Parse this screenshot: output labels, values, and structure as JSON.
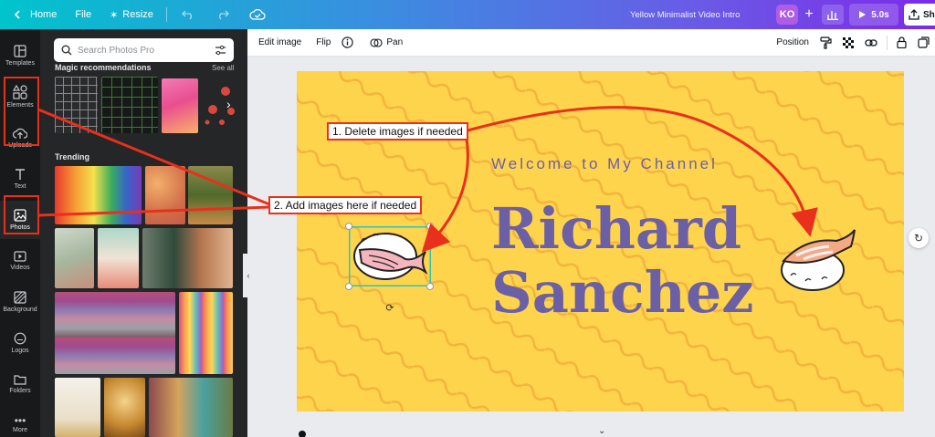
{
  "topbar": {
    "home_label": "Home",
    "file_label": "File",
    "resize_label": "Resize",
    "doc_title": "Yellow Minimalist Video Intro",
    "avatar_initials": "KO",
    "play_label": "5.0s",
    "share_label": "Sh"
  },
  "rail": {
    "items": [
      {
        "label": "Templates",
        "icon": "templates-icon"
      },
      {
        "label": "Elements",
        "icon": "elements-icon"
      },
      {
        "label": "Uploads",
        "icon": "upload-icon"
      },
      {
        "label": "Text",
        "icon": "text-icon"
      },
      {
        "label": "Photos",
        "icon": "photos-icon"
      },
      {
        "label": "Videos",
        "icon": "videos-icon"
      },
      {
        "label": "Background",
        "icon": "background-icon"
      },
      {
        "label": "Logos",
        "icon": "logos-icon"
      },
      {
        "label": "Folders",
        "icon": "folders-icon"
      },
      {
        "label": "More",
        "icon": "more-icon"
      }
    ]
  },
  "panel": {
    "search_placeholder": "Search Photos Pro",
    "magic_title": "Magic recommendations",
    "see_all": "See all",
    "trending_title": "Trending"
  },
  "ctx": {
    "edit_image": "Edit image",
    "flip": "Flip",
    "pan": "Pan",
    "position": "Position"
  },
  "canvas": {
    "welcome": "Welcome to My Channel",
    "name_line1": "Richard",
    "name_line2": "Sanchez",
    "bg_color": "#fed44d",
    "text_color": "#6b5fa5"
  },
  "annotations": {
    "delete_note": "1. Delete images if needed",
    "add_note": "2. Add images here if needed",
    "color": "#e8301c"
  }
}
